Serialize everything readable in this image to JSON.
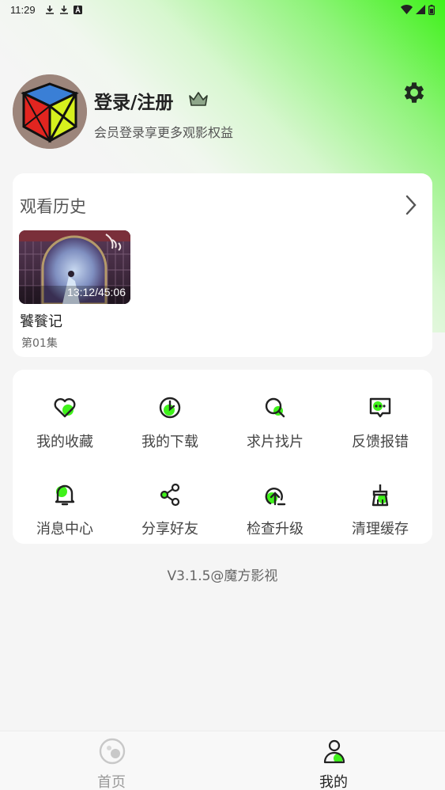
{
  "status_bar": {
    "time": "11:29",
    "left_icons": [
      "download-icon",
      "download-icon",
      "app-a-icon"
    ],
    "right_icons": [
      "wifi-icon",
      "signal-icon",
      "battery-icon"
    ]
  },
  "profile": {
    "title": "登录/注册",
    "subtitle": "会员登录享更多观影权益",
    "avatar_icon": "rubiks-cube-avatar",
    "crown_icon": "crown-icon",
    "settings_icon": "gear-icon"
  },
  "history": {
    "title": "观看历史",
    "items": [
      {
        "title": "饕餮记",
        "episode": "第01集",
        "progress": "13:12/45:06"
      }
    ]
  },
  "menu": {
    "items": [
      {
        "label": "我的收藏",
        "icon": "heart-icon"
      },
      {
        "label": "我的下载",
        "icon": "download-circle-icon"
      },
      {
        "label": "求片找片",
        "icon": "search-icon"
      },
      {
        "label": "反馈报错",
        "icon": "feedback-icon"
      },
      {
        "label": "消息中心",
        "icon": "bell-icon"
      },
      {
        "label": "分享好友",
        "icon": "share-icon"
      },
      {
        "label": "检查升级",
        "icon": "upgrade-icon"
      },
      {
        "label": "清理缓存",
        "icon": "broom-icon"
      }
    ]
  },
  "version": "V3.1.5@魔方影视",
  "tabbar": {
    "tabs": [
      {
        "label": "首页",
        "icon": "home-icon",
        "active": false
      },
      {
        "label": "我的",
        "icon": "profile-icon",
        "active": true
      }
    ]
  },
  "colors": {
    "accent": "#3ff21a",
    "active_text": "#222222",
    "inactive_text": "#999999"
  }
}
